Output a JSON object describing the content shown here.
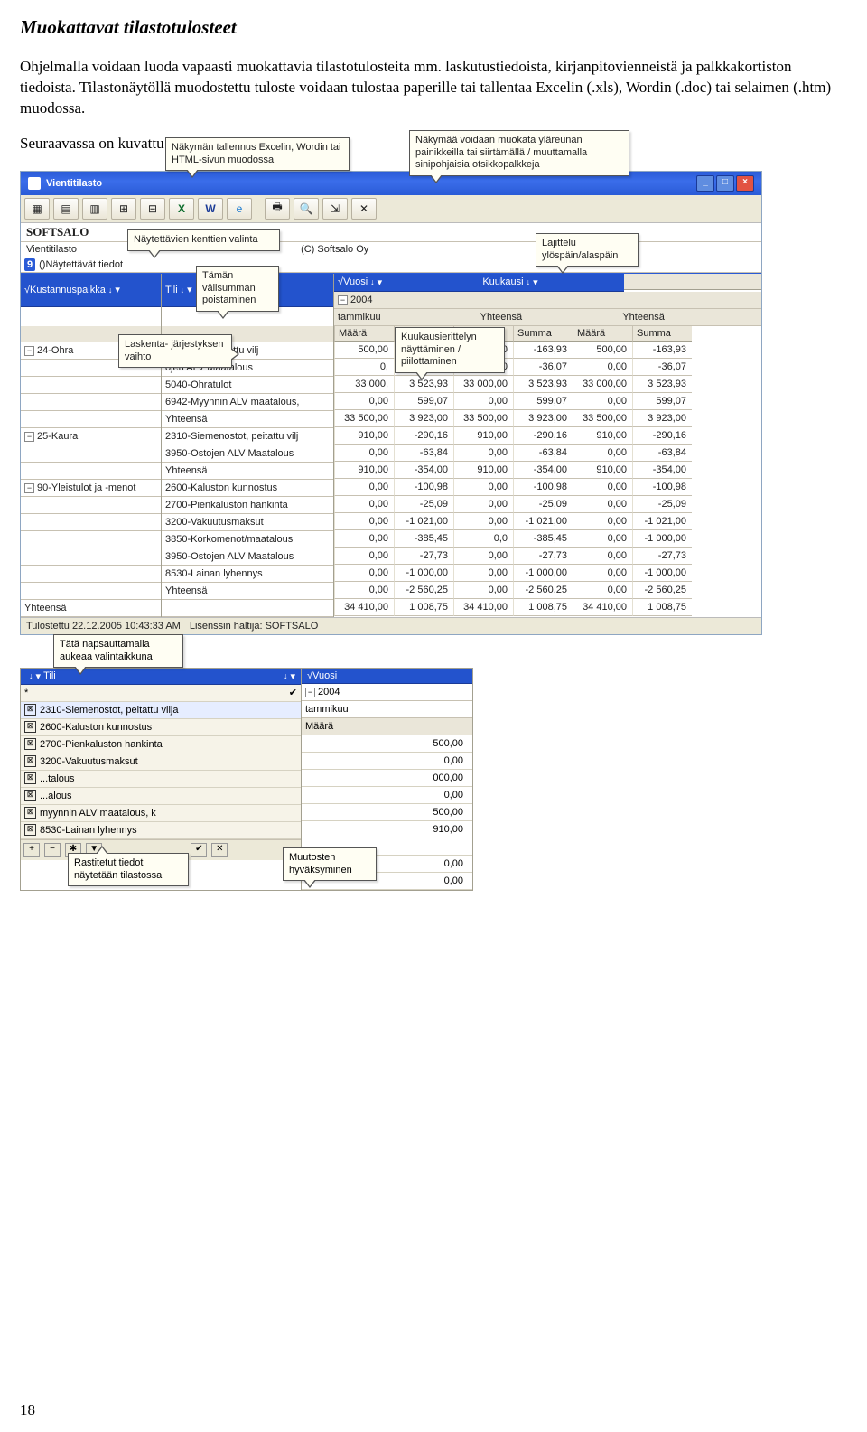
{
  "heading": "Muokattavat tilastotulosteet",
  "para1": "Ohjelmalla voidaan luoda vapaasti muokattavia tilastotulosteita mm. laskutustiedoista, kirjanpitovienneistä ja palkkakortiston tiedoista. Tilastonäytöllä muodostettu tuloste voidaan tulostaa paperille tai tallentaa Excelin (.xls), Wordin (.doc) tai selaimen (.htm) muodossa.",
  "para2": "Seuraavassa on kuvattu tilastonäytön päätoiminnot:",
  "shot1": {
    "title": "Vientitilasto",
    "brand": "SOFTSALO",
    "subtitle_left": "Vientitilasto",
    "subtitle_right": "(C) Softsalo Oy",
    "displayed_fields": "Näytettävät tiedot",
    "col_kustannus": "Kustannuspaikka",
    "col_tili": "Tili",
    "col_vuosi": "Vuosi",
    "col_kuukausi": "Kuukausi",
    "year": "2004",
    "month": "tammikuu",
    "yhteensa": "Yhteensä",
    "hd_maara": "Määrä",
    "hd_summa": "Summa",
    "groups": [
      {
        "name": "24-Ohra",
        "rows": [
          {
            "tili": "menostot, peitattu vilj",
            "m": "500,00",
            "s": "-163,93"
          },
          {
            "tili": "ojen ALV Maatalous",
            "m": "0,",
            "s": "-36,07"
          },
          {
            "tili": "5040-Ohratulot",
            "m": "33 000,",
            "s": "3 523,93"
          },
          {
            "tili": "6942-Myynnin ALV maatalous,",
            "m": "0,00",
            "s": "599,07"
          },
          {
            "tili": "Yhteensä",
            "m": "33 500,00",
            "s": "3 923,00"
          }
        ],
        "m2": [
          "500,00",
          "0,00",
          "33 000,00",
          "0,00",
          "33 500,00"
        ],
        "s2": [
          "-163,93",
          "-36,07",
          "3 523,93",
          "599,07",
          "3 923,00"
        ],
        "m3": [
          "500,00",
          "0,00",
          "33 000,00",
          "0,00",
          "33 500,00"
        ],
        "s3": [
          "-163,93",
          "-36,07",
          "3 523,93",
          "599,07",
          "3 923,00"
        ]
      },
      {
        "name": "25-Kaura",
        "rows": [
          {
            "tili": "2310-Siemenostot, peitattu vilj",
            "m": "910,00",
            "s": "-290,16"
          },
          {
            "tili": "3950-Ostojen ALV Maatalous",
            "m": "0,00",
            "s": "-63,84"
          },
          {
            "tili": "Yhteensä",
            "m": "910,00",
            "s": "-354,00"
          }
        ],
        "m2": [
          "910,00",
          "0,00",
          "910,00"
        ],
        "s2": [
          "-290,16",
          "-63,84",
          "-354,00"
        ],
        "m3": [
          "910,00",
          "0,00",
          "910,00"
        ],
        "s3": [
          "-290,16",
          "-63,84",
          "-354,00"
        ]
      },
      {
        "name": "90-Yleistulot ja -menot",
        "rows": [
          {
            "tili": "2600-Kaluston kunnostus",
            "m": "0,00",
            "s": "-100,98"
          },
          {
            "tili": "2700-Pienkaluston hankinta",
            "m": "0,00",
            "s": "-25,09"
          },
          {
            "tili": "3200-Vakuutusmaksut",
            "m": "0,00",
            "s": "-1 021,00"
          },
          {
            "tili": "3850-Korkomenot/maatalous",
            "m": "0,00",
            "s": "-385,45"
          },
          {
            "tili": "3950-Ostojen ALV Maatalous",
            "m": "0,00",
            "s": "-27,73"
          },
          {
            "tili": "8530-Lainan lyhennys",
            "m": "0,00",
            "s": "-1 000,00"
          },
          {
            "tili": "Yhteensä",
            "m": "0,00",
            "s": "-2 560,25"
          }
        ],
        "m2": [
          "0,00",
          "0,00",
          "0,00",
          "0,0",
          "0,00",
          "0,00",
          "0,00"
        ],
        "s2": [
          "-100,98",
          "-25,09",
          "-1 021,00",
          "-385,45",
          "-27,73",
          "-1 000,00",
          "-2 560,25"
        ],
        "m3": [
          "0,00",
          "0,00",
          "0,00",
          "0,00",
          "0,00",
          "0,00",
          "0,00"
        ],
        "s3": [
          "-100,98",
          "-25,09",
          "-1 021,00",
          "-1 000,00",
          "-27,73",
          "-1 000,00",
          "-2 560,25"
        ]
      }
    ],
    "grand": {
      "label": "Yhteensä",
      "m": "34 410,00",
      "s": "1 008,75",
      "m2": "34 410,00",
      "s2": "1 008,75",
      "m3": "34 410,00",
      "s3": "1 008,75"
    },
    "status_left": "Tulostettu 22.12.2005 10:43:33 AM",
    "status_right": "Lisenssin haltija: SOFTSALO",
    "callouts": {
      "save": "Näkymän tallennus Excelin,\nWordin tai HTML-sivun muodossa",
      "layout": "Näkymää voidaan muokata yläreunan\npainikkeilla tai siirtämällä / muuttamalla\nsinipohjaisia otsikkopalkkeja",
      "fields": "Näytettävien kenttien valinta",
      "sum": "Tämän\nvälisumman\npoistaminen",
      "sort": "Lajittelu\nylöspäin/alaspäin",
      "order": "Laskenta-\njärjestyksen vaihto",
      "month": "Kuukausierittelyn\nnäyttäminen /\npiilottaminen"
    }
  },
  "shot2": {
    "col_tili": "Tili",
    "col_vuosi": "Vuosi",
    "year": "2004",
    "month": "tammikuu",
    "hd_maara": "Määrä",
    "star": "*",
    "items": [
      "2310-Siemenostot, peitattu vilja",
      "2600-Kaluston kunnostus",
      "2700-Pienkaluston hankinta",
      "3200-Vakuutusmaksut",
      "...talous",
      "...alous",
      "myynnin ALV maatalous, k",
      "8530-Lainan lyhennys"
    ],
    "values": [
      "500,00",
      "0,00",
      "000,00",
      "0,00",
      "500,00",
      "910,00",
      "",
      "0,00",
      "0,00"
    ],
    "callouts": {
      "open": "Tätä napsauttamalla\naukeaa valintaikkuna",
      "checked": "Rastitetut tiedot\nnäytetään tilastossa",
      "apply": "Muutosten\nhyväksyminen"
    }
  },
  "page_number": "18"
}
